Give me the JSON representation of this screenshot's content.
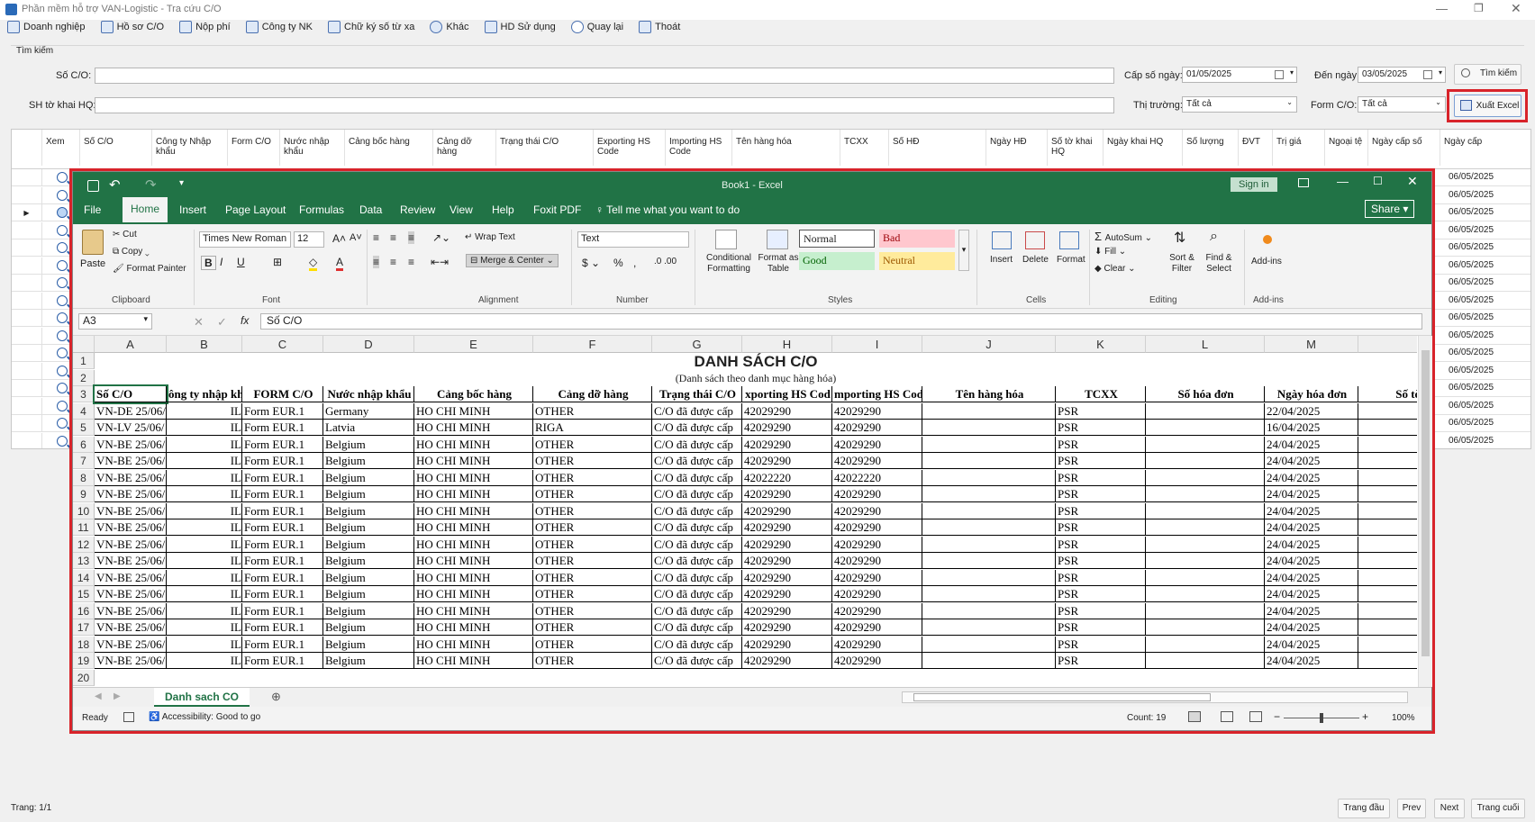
{
  "window": {
    "title": "Phần mềm hỗ trợ VAN-Logistic - Tra cứu C/O"
  },
  "menu": [
    {
      "label": "Doanh nghiệp",
      "icon": "building-icon"
    },
    {
      "label": "Hồ sơ C/O",
      "icon": "document-icon"
    },
    {
      "label": "Nộp phí",
      "icon": "payment-icon"
    },
    {
      "label": "Công ty NK",
      "icon": "company-icon"
    },
    {
      "label": "Chữ ký số từ xa",
      "icon": "signature-icon"
    },
    {
      "label": "Khác",
      "icon": "gear-icon"
    },
    {
      "label": "HD Sử dụng",
      "icon": "help-icon"
    },
    {
      "label": "Quay lại",
      "icon": "back-icon"
    },
    {
      "label": "Thoát",
      "icon": "exit-icon"
    }
  ],
  "search": {
    "group": "Tìm kiếm",
    "so_co_label": "Số C/O:",
    "sh_label": "SH tờ khai HQ:",
    "cap_so_ngay_label": "Cấp số ngày:",
    "cap_so_ngay_value": "01/05/2025",
    "den_ngay_label": "Đến ngày",
    "den_ngay_value": "03/05/2025",
    "thi_truong_label": "Thị trường:",
    "thi_truong_value": "Tất cả",
    "form_label": "Form C/O:",
    "form_value": "Tất cả",
    "search_btn": "Tìm kiếm",
    "export_btn": "Xuất Excel"
  },
  "grid": {
    "headers": [
      "Xem",
      "Số C/O",
      "Công ty Nhập khẩu",
      "Form C/O",
      "Nước nhập khẩu",
      "Cảng bốc hàng",
      "Cảng dỡ hàng",
      "Trạng thái C/O",
      "Exporting HS Code",
      "Importing HS Code",
      "Tên hàng hóa",
      "TCXX",
      "Số HĐ",
      "Ngày HĐ",
      "Số tờ khai HQ",
      "Ngày khai HQ",
      "Số lượng",
      "ĐVT",
      "Trị giá",
      "Ngoại tệ",
      "Ngày cấp số",
      "Ngày cấp"
    ],
    "dates": [
      "06/05/2025",
      "06/05/2025",
      "06/05/2025",
      "06/05/2025",
      "06/05/2025",
      "06/05/2025",
      "06/05/2025",
      "06/05/2025",
      "06/05/2025",
      "06/05/2025",
      "06/05/2025",
      "06/05/2025",
      "06/05/2025",
      "06/05/2025",
      "06/05/2025",
      "06/05/2025"
    ]
  },
  "footer": {
    "page": "Trang: 1/1",
    "first": "Trang đầu",
    "prev": "Prev",
    "next": "Next",
    "last": "Trang cuối"
  },
  "excel": {
    "title": "Book1 - Excel",
    "signin": "Sign in",
    "share": "Share",
    "tabs": [
      "File",
      "Home",
      "Insert",
      "Page Layout",
      "Formulas",
      "Data",
      "Review",
      "View",
      "Help",
      "Foxit PDF"
    ],
    "tell": "Tell me what you want to do",
    "clipboard": {
      "paste": "Paste",
      "cut": "Cut",
      "copy": "Copy",
      "painter": "Format Painter",
      "label": "Clipboard"
    },
    "font": {
      "name": "Times New Roman",
      "size": "12",
      "label": "Font"
    },
    "alignment": {
      "wrap": "Wrap Text",
      "merge": "Merge & Center",
      "label": "Alignment"
    },
    "number": {
      "format": "Text",
      "label": "Number"
    },
    "styles": {
      "cond": "Conditional Formatting",
      "table": "Format as Table",
      "normal": "Normal",
      "bad": "Bad",
      "good": "Good",
      "neutral": "Neutral",
      "label": "Styles"
    },
    "cells": {
      "insert": "Insert",
      "delete": "Delete",
      "format": "Format",
      "label": "Cells"
    },
    "editing": {
      "autosum": "AutoSum",
      "fill": "Fill",
      "clear": "Clear",
      "sort": "Sort & Filter",
      "find": "Find & Select",
      "label": "Editing"
    },
    "addins": {
      "btn": "Add-ins",
      "label": "Add-ins"
    },
    "namebox": "A3",
    "formula": "Số C/O",
    "cols": [
      "A",
      "B",
      "C",
      "D",
      "E",
      "F",
      "G",
      "H",
      "I",
      "J",
      "K",
      "L",
      "M",
      ""
    ],
    "sheet_title": "DANH SÁCH C/O",
    "sheet_subtitle": "(Danh sách theo danh mục hàng hóa)",
    "table_headers": [
      "Số C/O",
      "ông ty nhập kh",
      "FORM C/O",
      "Nước nhập khẩu",
      "Cảng bốc hàng",
      "Cảng dỡ hàng",
      "Trạng thái C/O",
      "xporting HS Cod",
      "mporting HS Cod",
      "Tên hàng hóa",
      "TCXX",
      "Số hóa đơn",
      "Ngày hóa đơn",
      "Số tờ"
    ],
    "rows": [
      [
        "VN-DE 25/06/",
        "IL",
        "Form EUR.1",
        "Germany",
        "HO CHI MINH",
        "OTHER",
        "C/O đã được cấp",
        "42029290",
        "42029290",
        "",
        "PSR",
        "",
        "22/04/2025",
        ""
      ],
      [
        "VN-LV 25/06/",
        "IL",
        "Form EUR.1",
        "Latvia",
        "HO CHI MINH",
        "RIGA",
        "C/O đã được cấp",
        "42029290",
        "42029290",
        "",
        "PSR",
        "",
        "16/04/2025",
        ""
      ],
      [
        "VN-BE 25/06/",
        "IL",
        "Form EUR.1",
        "Belgium",
        "HO CHI MINH",
        "OTHER",
        "C/O đã được cấp",
        "42029290",
        "42029290",
        "",
        "PSR",
        "",
        "24/04/2025",
        ""
      ],
      [
        "VN-BE 25/06/",
        "IL",
        "Form EUR.1",
        "Belgium",
        "HO CHI MINH",
        "OTHER",
        "C/O đã được cấp",
        "42029290",
        "42029290",
        "",
        "PSR",
        "",
        "24/04/2025",
        ""
      ],
      [
        "VN-BE 25/06/",
        "IL",
        "Form EUR.1",
        "Belgium",
        "HO CHI MINH",
        "OTHER",
        "C/O đã được cấp",
        "42022220",
        "42022220",
        "",
        "PSR",
        "",
        "24/04/2025",
        ""
      ],
      [
        "VN-BE 25/06/",
        "IL",
        "Form EUR.1",
        "Belgium",
        "HO CHI MINH",
        "OTHER",
        "C/O đã được cấp",
        "42029290",
        "42029290",
        "",
        "PSR",
        "",
        "24/04/2025",
        ""
      ],
      [
        "VN-BE 25/06/",
        "IL",
        "Form EUR.1",
        "Belgium",
        "HO CHI MINH",
        "OTHER",
        "C/O đã được cấp",
        "42029290",
        "42029290",
        "",
        "PSR",
        "",
        "24/04/2025",
        ""
      ],
      [
        "VN-BE 25/06/",
        "IL",
        "Form EUR.1",
        "Belgium",
        "HO CHI MINH",
        "OTHER",
        "C/O đã được cấp",
        "42029290",
        "42029290",
        "",
        "PSR",
        "",
        "24/04/2025",
        ""
      ],
      [
        "VN-BE 25/06/",
        "IL",
        "Form EUR.1",
        "Belgium",
        "HO CHI MINH",
        "OTHER",
        "C/O đã được cấp",
        "42029290",
        "42029290",
        "",
        "PSR",
        "",
        "24/04/2025",
        ""
      ],
      [
        "VN-BE 25/06/",
        "IL",
        "Form EUR.1",
        "Belgium",
        "HO CHI MINH",
        "OTHER",
        "C/O đã được cấp",
        "42029290",
        "42029290",
        "",
        "PSR",
        "",
        "24/04/2025",
        ""
      ],
      [
        "VN-BE 25/06/",
        "IL",
        "Form EUR.1",
        "Belgium",
        "HO CHI MINH",
        "OTHER",
        "C/O đã được cấp",
        "42029290",
        "42029290",
        "",
        "PSR",
        "",
        "24/04/2025",
        ""
      ],
      [
        "VN-BE 25/06/",
        "IL",
        "Form EUR.1",
        "Belgium",
        "HO CHI MINH",
        "OTHER",
        "C/O đã được cấp",
        "42029290",
        "42029290",
        "",
        "PSR",
        "",
        "24/04/2025",
        ""
      ],
      [
        "VN-BE 25/06/",
        "IL",
        "Form EUR.1",
        "Belgium",
        "HO CHI MINH",
        "OTHER",
        "C/O đã được cấp",
        "42029290",
        "42029290",
        "",
        "PSR",
        "",
        "24/04/2025",
        ""
      ],
      [
        "VN-BE 25/06/",
        "IL",
        "Form EUR.1",
        "Belgium",
        "HO CHI MINH",
        "OTHER",
        "C/O đã được cấp",
        "42029290",
        "42029290",
        "",
        "PSR",
        "",
        "24/04/2025",
        ""
      ],
      [
        "VN-BE 25/06/",
        "IL",
        "Form EUR.1",
        "Belgium",
        "HO CHI MINH",
        "OTHER",
        "C/O đã được cấp",
        "42029290",
        "42029290",
        "",
        "PSR",
        "",
        "24/04/2025",
        ""
      ],
      [
        "VN-BE 25/06/",
        "IL",
        "Form EUR.1",
        "Belgium",
        "HO CHI MINH",
        "OTHER",
        "C/O đã được cấp",
        "42029290",
        "42029290",
        "",
        "PSR",
        "",
        "24/04/2025",
        ""
      ]
    ],
    "sheet_tab": "Danh sach CO",
    "status_ready": "Ready",
    "accessibility": "Accessibility: Good to go",
    "count": "Count: 19",
    "zoom": "100%"
  }
}
